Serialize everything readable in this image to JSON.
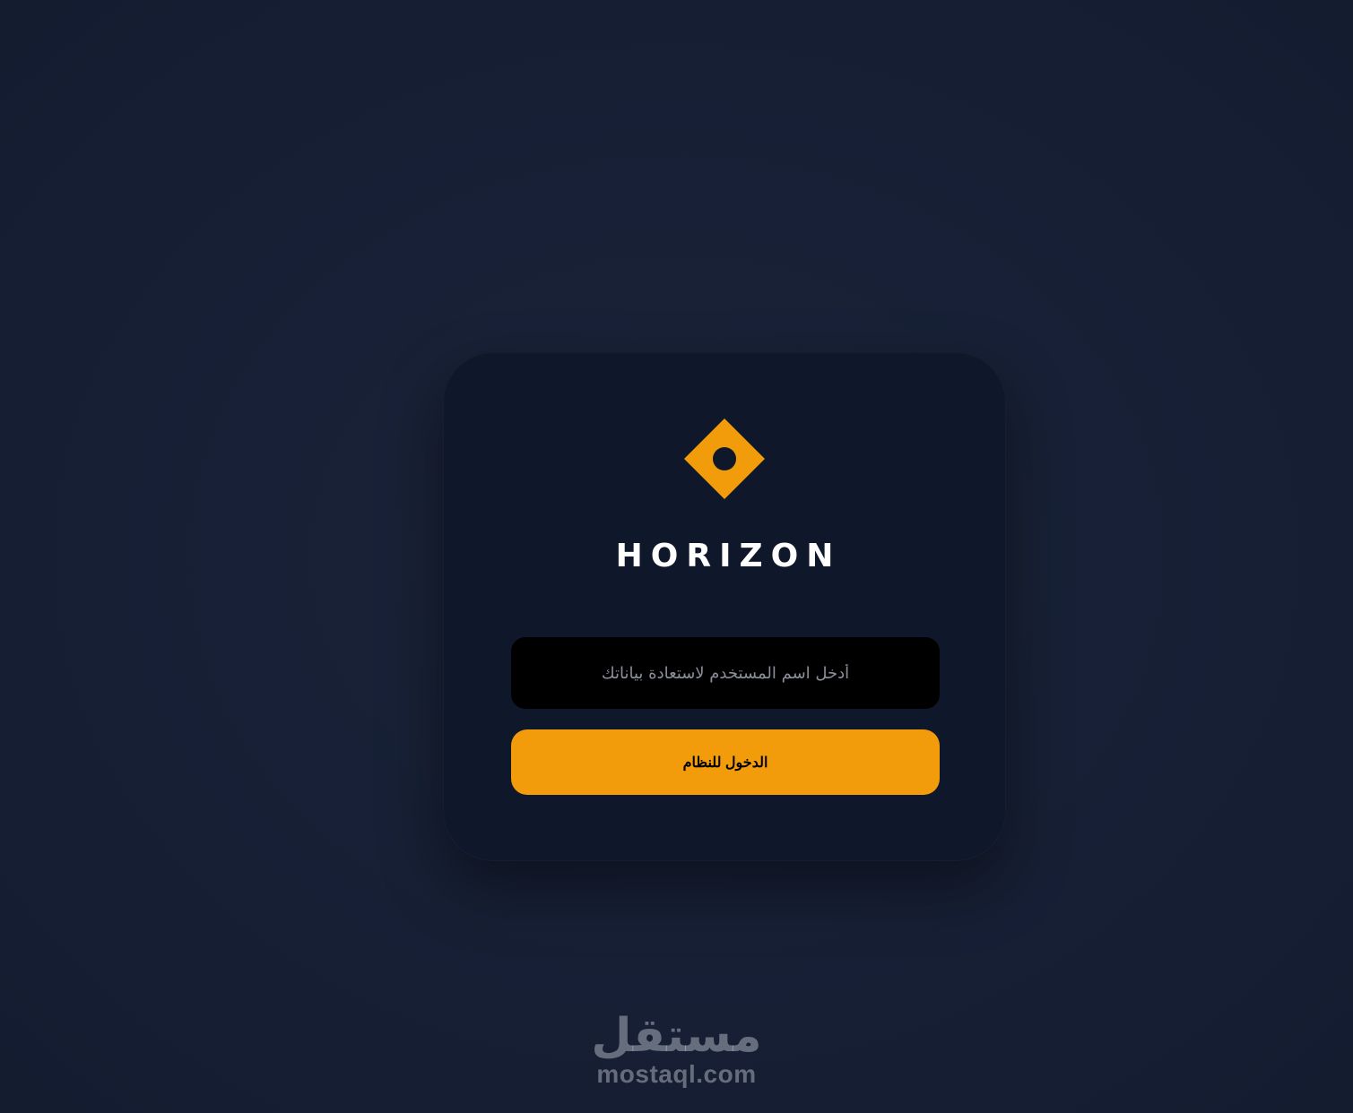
{
  "brand": {
    "name": "HORIZON",
    "accent_color": "#f39c0b",
    "logo_icon": "diamond-with-dot-icon"
  },
  "form": {
    "username_placeholder": "أدخل اسم المستخدم لاستعادة بياناتك",
    "username_value": "",
    "submit_label": "الدخول للنظام"
  },
  "watermark": {
    "arabic": "مستقل",
    "latin": "mostaql.com"
  }
}
